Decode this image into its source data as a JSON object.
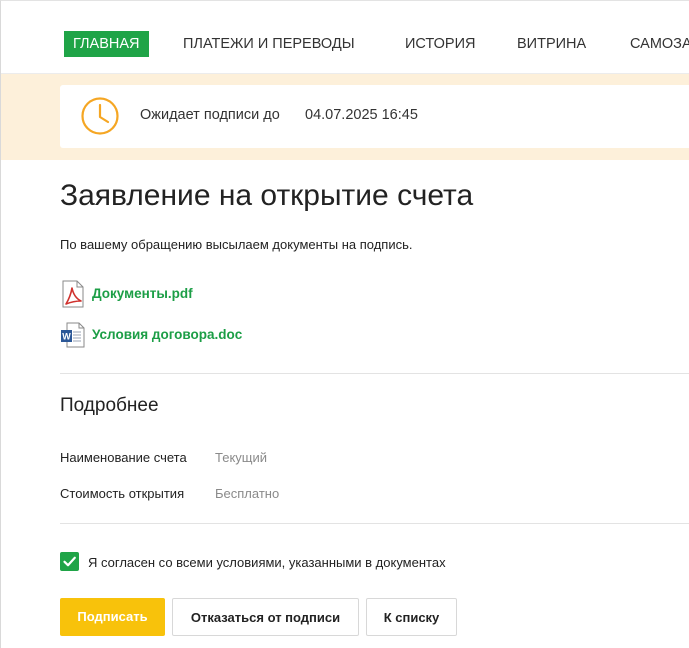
{
  "nav": {
    "items": [
      {
        "label": "ГЛАВНАЯ",
        "active": true
      },
      {
        "label": "ПЛАТЕЖИ И ПЕРЕВОДЫ",
        "active": false
      },
      {
        "label": "ИСТОРИЯ",
        "active": false
      },
      {
        "label": "ВИТРИНА",
        "active": false
      },
      {
        "label": "САМОЗА",
        "active": false
      }
    ]
  },
  "banner": {
    "icon": "clock-icon",
    "label": "Ожидает подписи до",
    "deadline": "04.07.2025 16:45"
  },
  "main": {
    "title": "Заявление на открытие счета",
    "intro": "По вашему обращению высылаем документы на подпись.",
    "documents": [
      {
        "name": "Документы.pdf",
        "icon": "pdf-file-icon"
      },
      {
        "name": "Условия договора.doc",
        "icon": "word-file-icon"
      }
    ]
  },
  "details": {
    "title": "Подробнее",
    "rows": [
      {
        "label": "Наименование счета",
        "value": "Текущий"
      },
      {
        "label": "Стоимость открытия",
        "value": "Бесплатно"
      }
    ]
  },
  "agreement": {
    "checked": true,
    "label": "Я согласен со всеми условиями, указанными в документах"
  },
  "actions": {
    "sign": "Подписать",
    "decline": "Отказаться от подписи",
    "back": "К списку"
  },
  "colors": {
    "accent_green": "#1fa447",
    "link_green": "#1c9e46",
    "button_yellow": "#f8c20b",
    "banner_bg": "#fdf0da",
    "clock_orange": "#f5a623"
  }
}
